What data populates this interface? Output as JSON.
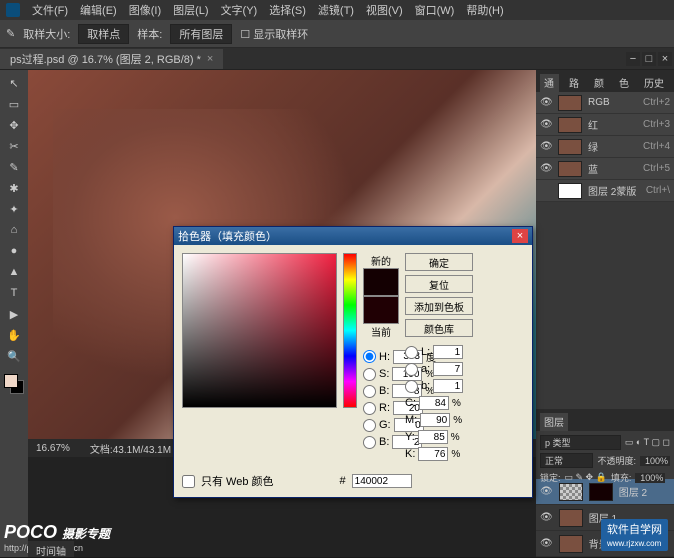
{
  "menubar": [
    "文件(F)",
    "编辑(E)",
    "图像(I)",
    "图层(L)",
    "文字(Y)",
    "选择(S)",
    "滤镜(T)",
    "视图(V)",
    "窗口(W)",
    "帮助(H)"
  ],
  "optbar": {
    "label1": "取样大小:",
    "sel1": "取样点",
    "label2": "样本:",
    "sel2": "所有图层",
    "chk": "显示取样环"
  },
  "doctab": {
    "title": "ps过程.psd @ 16.7% (图层 2, RGB/8) *"
  },
  "tools": [
    "↖",
    "▭",
    "✥",
    "✂",
    "✎",
    "✱",
    "✦",
    "⌂",
    "●",
    "▲",
    "T",
    "▶",
    "✋",
    "🔍"
  ],
  "status": {
    "zoom": "16.67%",
    "docinfo": "文档:43.1M/43.1M"
  },
  "paneltabs": [
    "通道",
    "路径",
    "颜色",
    "色板",
    "历史记录"
  ],
  "channels": [
    {
      "name": "RGB",
      "shortcut": "Ctrl+2"
    },
    {
      "name": "红",
      "shortcut": "Ctrl+3"
    },
    {
      "name": "绿",
      "shortcut": "Ctrl+4"
    },
    {
      "name": "蓝",
      "shortcut": "Ctrl+5"
    },
    {
      "name": "图层 2蒙版",
      "shortcut": "Ctrl+\\"
    }
  ],
  "layers_tab": "图层",
  "layeropts": {
    "kind": "p 类型",
    "mode": "正常",
    "opacity_lbl": "不透明度:",
    "opacity": "100%",
    "lock_lbl": "锁定:",
    "fill_lbl": "填充:",
    "fill": "100%"
  },
  "layerlist": [
    {
      "name": "图层 2",
      "sel": true,
      "fill": true
    },
    {
      "name": "图层 1"
    },
    {
      "name": "背景"
    }
  ],
  "picker": {
    "title": "拾色器（填充颜色）",
    "new": "新的",
    "current": "当前",
    "btns": [
      "确定",
      "复位",
      "添加到色板",
      "颜色库"
    ],
    "H": {
      "l": "H:",
      "v": "353",
      "u": "度"
    },
    "S": {
      "l": "S:",
      "v": "100",
      "u": "%"
    },
    "B": {
      "l": "B:",
      "v": "8",
      "u": "%"
    },
    "R": {
      "l": "R:",
      "v": "20",
      "u": ""
    },
    "G": {
      "l": "G:",
      "v": "0",
      "u": ""
    },
    "Bb": {
      "l": "B:",
      "v": "2",
      "u": ""
    },
    "L": {
      "l": "L:",
      "v": "1",
      "u": ""
    },
    "a": {
      "l": "a:",
      "v": "7",
      "u": ""
    },
    "b": {
      "l": "b:",
      "v": "1",
      "u": ""
    },
    "C": {
      "l": "C:",
      "v": "84",
      "u": "%"
    },
    "M": {
      "l": "M:",
      "v": "90",
      "u": "%"
    },
    "Y": {
      "l": "Y:",
      "v": "85",
      "u": "%"
    },
    "K": {
      "l": "K:",
      "v": "76",
      "u": "%"
    },
    "webonly": "只有 Web 颜色",
    "hexlbl": "#",
    "hex": "140002"
  },
  "watermark": {
    "brand": "POCO",
    "sub": "摄影专题",
    "url": "http://photo.poco.cn"
  },
  "watermark2": "软件自学网",
  "watermark2_url": "www.rjzxw.com",
  "timeline": "时间轴"
}
